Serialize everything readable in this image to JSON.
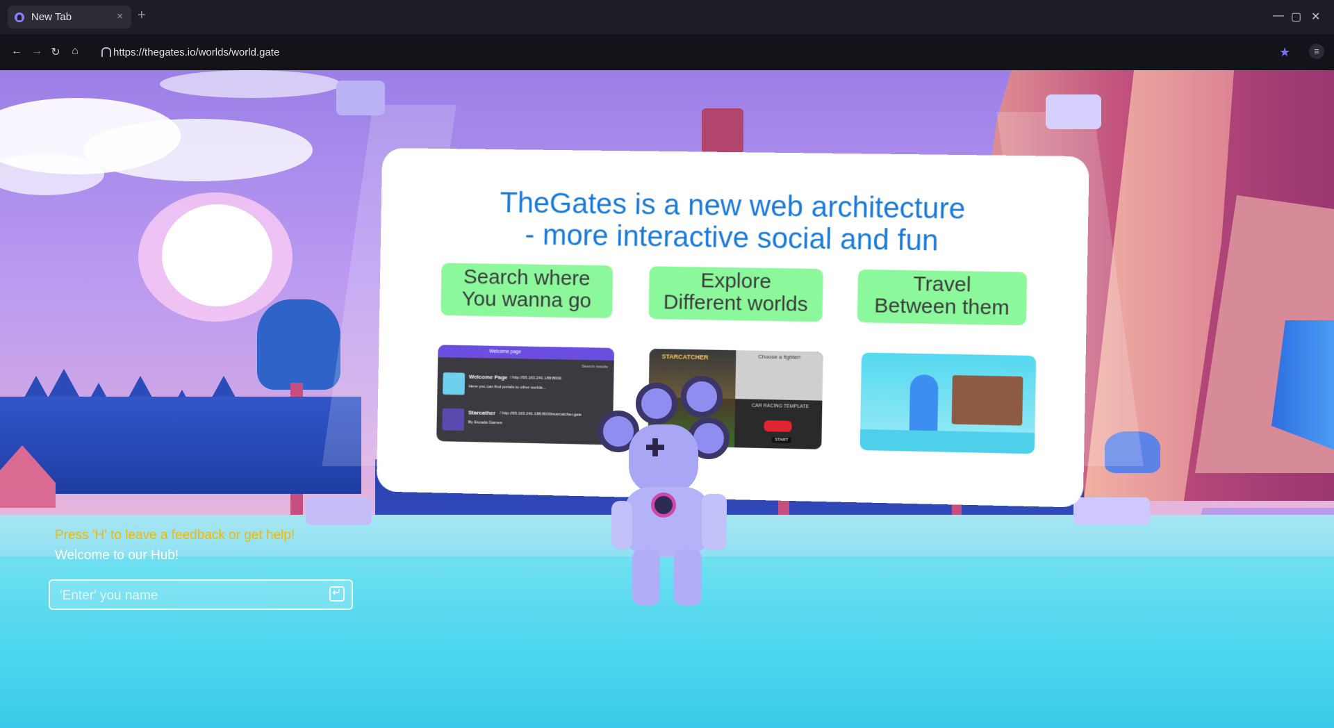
{
  "browser": {
    "tab_title": "New Tab",
    "tab_close": "×",
    "new_tab": "+",
    "url": "https://thegates.io/worlds/world.gate",
    "nav": {
      "back": "←",
      "forward": "→",
      "reload": "↻",
      "home": "⌂"
    },
    "window": {
      "minimize": "—",
      "maximize": "▢",
      "close": "✕"
    },
    "menu": "≡"
  },
  "board": {
    "title_line1": "TheGates is a new web architecture",
    "title_line2": "- more interactive social and fun",
    "cards": [
      {
        "line1": "Search where",
        "line2": "You wanna go"
      },
      {
        "line1": "Explore",
        "line2": "Different worlds"
      },
      {
        "line1": "Travel",
        "line2": "Between them"
      }
    ],
    "shot1": {
      "bar": "Welcome page",
      "search_label": "Search results",
      "r1_title": "Welcome Page",
      "r1_url": "/ http://95.163.241.188:8000",
      "r1_desc": "Here you can find portals to other worlds...",
      "r2_title": "Starcather",
      "r2_url": "/ http://95.163.241.188:8000/starcatcher.gate",
      "r2_desc": "By Escada Games"
    },
    "shot2": {
      "q1": "STARCATCHER",
      "q2": "Choose a fighter!",
      "q3": "CAR RACING TEMPLATE",
      "q4": "START"
    }
  },
  "hud": {
    "help": "Press 'H' to leave a feedback or get help!",
    "welcome": "Welcome to our Hub!",
    "name_placeholder": "'Enter' you name"
  }
}
